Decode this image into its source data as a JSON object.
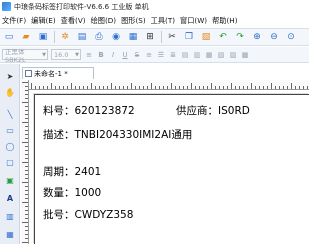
{
  "window": {
    "title": "中琅条码标签打印软件-V6.6.6 工业版 单机"
  },
  "menu": [
    "文件(F)",
    "编辑(E)",
    "查看(V)",
    "绘图(D)",
    "图形(S)",
    "工具(T)",
    "窗口(W)",
    "帮助(H)"
  ],
  "toolbar2": {
    "font_name": "正黑体 SBK2L",
    "font_size": "16.0"
  },
  "document": {
    "tab_title": "未命名-1 *"
  },
  "label": {
    "part_no_label": "料号：",
    "part_no_value": "620123872",
    "supplier_label": "供应商：",
    "supplier_value": "IS0RD",
    "desc_label": "描述：",
    "desc_value": "TNBI204330IMI2AI通用",
    "period_label": "周期：",
    "period_value": "2401",
    "qty_label": "数量：",
    "qty_value": "1000",
    "batch_label": "批号：",
    "batch_value": "CWDYZ358"
  }
}
